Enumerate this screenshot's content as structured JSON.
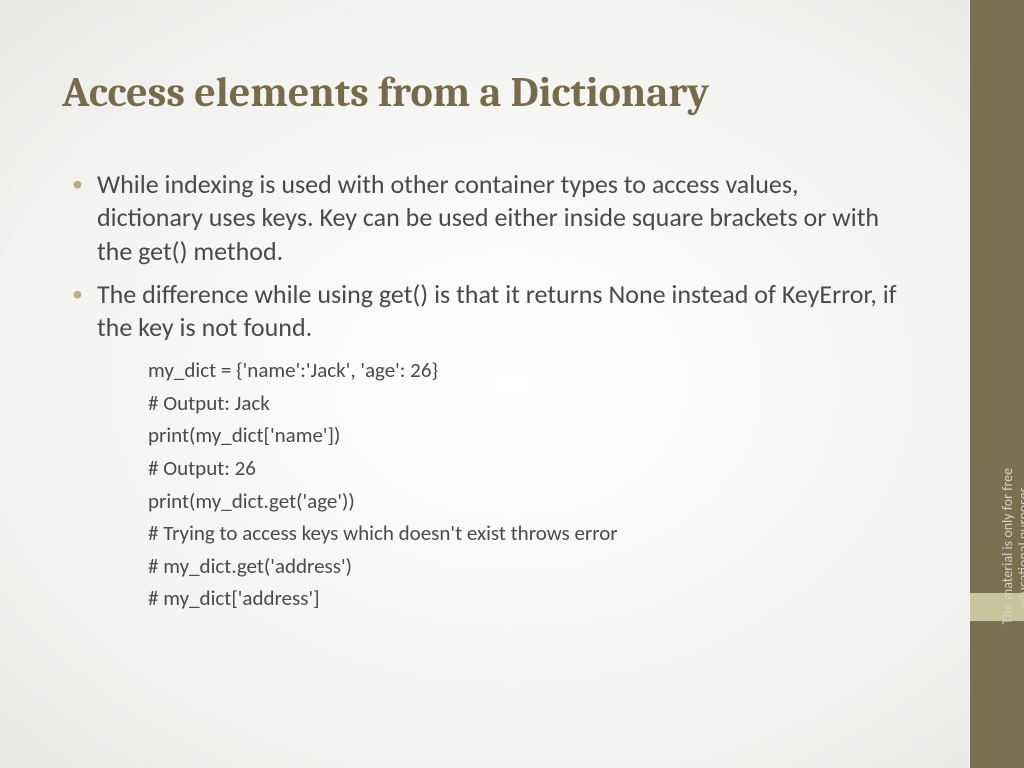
{
  "title": "Access elements from a Dictionary",
  "bullets": [
    "While indexing is used with other container types to access values, dictionary uses keys. Key can be used either inside square brackets or with the get() method.",
    "The difference while using get() is that it returns None instead of KeyError, if the key is not found."
  ],
  "code_lines": [
    "my_dict = {'name':'Jack', 'age': 26}",
    "# Output: Jack",
    "print(my_dict['name'])",
    "# Output: 26",
    "print(my_dict.get('age'))",
    "# Trying to access keys which doesn't exist throws error",
    "# my_dict.get('address')",
    "# my_dict['address']"
  ],
  "sidebar_note": "The material is only for free educational purposes."
}
